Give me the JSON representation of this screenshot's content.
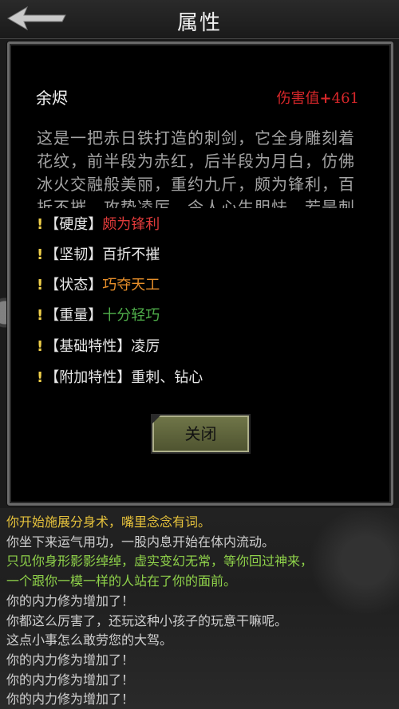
{
  "header": {
    "title": "属性"
  },
  "item": {
    "name": "余烬",
    "damage_label": "伤害值",
    "damage_sign": "+",
    "damage_value": "461",
    "description_lines": [
      "这是一把赤日铁打造的刺剑，它全身雕刻着",
      "花纹，前半段为赤红，后半段为月白，仿佛",
      "冰火交融般美丽，重约九斤，颇为锋利，百",
      "折不摧，攻势凌厉，令人心生胆怯，若是刺"
    ]
  },
  "attributes": [
    {
      "bang": "!",
      "key": "【硬度】",
      "value": "颇为锋利",
      "color": "#e03a3a"
    },
    {
      "bang": "!",
      "key": "【坚韧】",
      "value": "百折不摧",
      "color": "#e8e8e8"
    },
    {
      "bang": "!",
      "key": "【状态】",
      "value": "巧夺天工",
      "color": "#e88f2a"
    },
    {
      "bang": "!",
      "key": "【重量】",
      "value": "十分轻巧",
      "color": "#4fae4a"
    },
    {
      "bang": "!",
      "key": "【基础特性】",
      "value": "凌厉",
      "color": "#e8e8e8"
    },
    {
      "bang": "!",
      "key": "【附加特性】",
      "value": "重刺、钻心",
      "color": "#e8e8e8"
    }
  ],
  "buttons": {
    "close": "关闭"
  },
  "log": [
    {
      "text": "你开始施展分身术，嘴里念念有词。",
      "color": "#e6c23c"
    },
    {
      "text": "你坐下来运气用功，一股内息开始在体内流动。",
      "color": "#cfcfcf"
    },
    {
      "text": "只见你身形影影绰绰，虚实变幻无常，等你回过神来，",
      "color": "#8fd24a"
    },
    {
      "text": "一个跟你一模一样的人站在了你的面前。",
      "color": "#8fd24a"
    },
    {
      "text": "你的内力修为增加了！",
      "color": "#cfcfcf"
    },
    {
      "text": "你都这么厉害了，还玩这种小孩子的玩意干嘛呢。",
      "color": "#cfcfcf"
    },
    {
      "text": "这点小事怎么敢劳您的大驾。",
      "color": "#cfcfcf"
    },
    {
      "text": "你的内力修为增加了！",
      "color": "#cfcfcf"
    },
    {
      "text": "你的内力修为增加了！",
      "color": "#cfcfcf"
    },
    {
      "text": "你的内力修为增加了！",
      "color": "#cfcfcf"
    }
  ]
}
